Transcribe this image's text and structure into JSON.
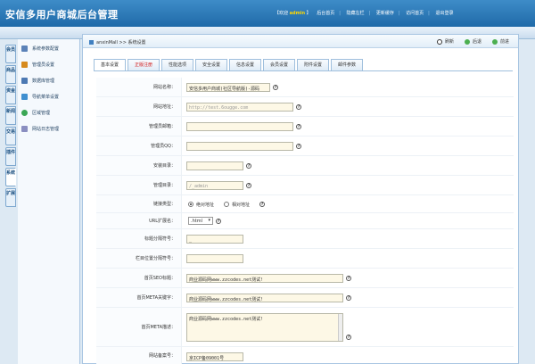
{
  "app": {
    "title": "安信多用户商城后台管理"
  },
  "top_links": {
    "welcome_prefix": "【欢迎",
    "username": "admin",
    "welcome_suffix": "】",
    "site_home": "后台首页",
    "hide_left": "隐藏左栏",
    "update_cache": "更新缓存",
    "visit_home": "访问首页",
    "logout": "退出登录"
  },
  "vertical_tabs": [
    "会员",
    "商品",
    "资金",
    "新闻",
    "交易",
    "插件",
    "系统",
    "扩展"
  ],
  "sidebar": {
    "items": [
      "系统参数配置",
      "管理员设置",
      "数据库管理",
      "导航菜单设置",
      "区域管理",
      "网站日志管理"
    ],
    "colors": [
      "#5b82b8",
      "#d68a1e",
      "#4c79b3",
      "#3f8fd0",
      "#3aa655",
      "#8a8ec0"
    ]
  },
  "breadcrumb": {
    "root": "anxinMall",
    "sep": ">>",
    "page": "系统设置"
  },
  "toolbar": {
    "refresh": "刷新",
    "back": "后退",
    "forward": "前进"
  },
  "tabs": [
    "基本设置",
    "正版注册",
    "性能选项",
    "安全设置",
    "信息设置",
    "会员设置",
    "附件设置",
    "邮件参数"
  ],
  "form": {
    "site_name": {
      "label": "网站名称：",
      "value": "安信多用户商城(社区导航版)-源码"
    },
    "site_url": {
      "label": "网站地址：",
      "value": "http://test.6ougge.com"
    },
    "admin_email": {
      "label": "管理员邮箱：",
      "value": ""
    },
    "admin_qq": {
      "label": "管理员QQ：",
      "value": ""
    },
    "install_dir": {
      "label": "安装目录：",
      "value": ""
    },
    "manage_dir": {
      "label": "管理目录：",
      "value": "/_admin"
    },
    "link_type": {
      "label": "链接类型：",
      "option1": "绝对地址",
      "option2": "相对地址"
    },
    "url_ext": {
      "label": "URL扩展名：",
      "value": ".html"
    },
    "title_sep": {
      "label": "标题分隔符号：",
      "value": "_"
    },
    "nav_sep": {
      "label": "栏目位置分隔符号：",
      "value": ""
    },
    "seo_title": {
      "label": "首页SEO标题：",
      "value": "商业源码网www.zzcodes.net测试!"
    },
    "meta_keywords": {
      "label": "首页META关键字：",
      "value": "商业源码网www.zzcodes.net测试!"
    },
    "meta_desc": {
      "label": "首页META描述：",
      "value": "商业源码网www.zzcodes.net测试!"
    },
    "record_no": {
      "label": "网站备案号：",
      "value": "京ICP备09001号"
    }
  }
}
